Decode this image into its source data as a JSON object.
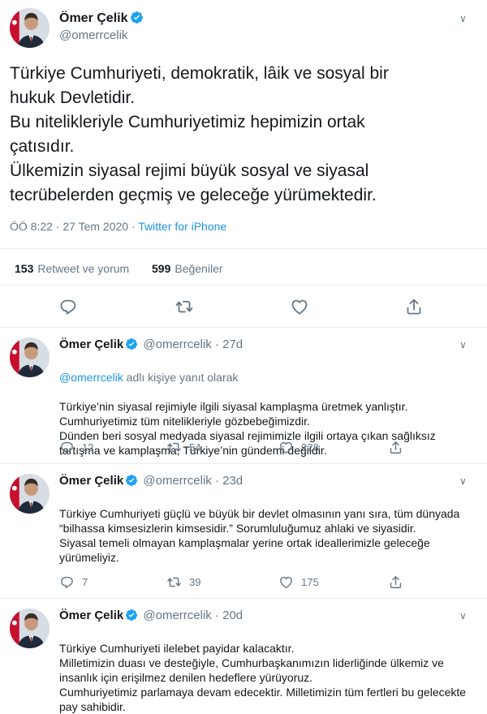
{
  "main_tweet": {
    "name": "Ömer Çelik",
    "handle": "@omerrcelik",
    "text": "Türkiye Cumhuriyeti, demokratik, lâik ve sosyal bir\nhukuk Devletidir.\nBu nitelikleriyle Cumhuriyetimiz hepimizin ortak\nçatısıdır.\nÜlkemizin siyasal rejimi büyük sosyal ve siyasal\ntecrübelerden geçmiş ve geleceğe yürümektedir.",
    "time": "ÖÖ 8:22 · 27 Tem 2020 · ",
    "source": "Twitter for iPhone",
    "retweets": "153",
    "retweets_label": "Retweet ve yorum",
    "likes": "599",
    "likes_label": "Beğeniler",
    "icons": [
      "reply-icon",
      "retweet-icon",
      "like-icon",
      "share-icon"
    ]
  },
  "replies": [
    {
      "name": "Ömer Çelik",
      "handle": "@omerrcelik · 27d",
      "reply_to_mention": "@omerrcelik",
      "reply_to_suffix": " adlı kişiye yanıt olarak",
      "text": "Türkiye’nin siyasal rejimiyle ilgili siyasal kamplaşma üretmek yanlıştır.\nCumhuriyetimiz tüm nitelikleriyle gözbebeğimizdir.\nDünden beri sosyal medyada siyasal rejimimizle ilgili ortaya çıkan sağlıksız tartışma ve kamplaşma, Türkiye’nin gündemi değildir.",
      "replies": "12",
      "retweets": "54",
      "likes": "228"
    },
    {
      "name": "Ömer Çelik",
      "handle": "@omerrcelik · 23d",
      "text": "Türkiye Cumhuriyeti güçlü ve büyük bir devlet olmasının yanı sıra, tüm dünyada “bilhassa kimsesizlerin kimsesidir.” Sorumluluğumuz ahlaki ve siyasidir.\nSiyasal temeli olmayan kamplaşmalar yerine ortak ideallerimizle geleceğe yürümeliyiz.",
      "replies": "7",
      "retweets": "39",
      "likes": "175"
    },
    {
      "name": "Ömer Çelik",
      "handle": "@omerrcelik · 20d",
      "text": "Türkiye Cumhuriyeti ilelebet payidar kalacaktır.\nMilletimizin duası ve desteğiyle, Cumhurbaşkanımızın liderliğinde ülkemiz ve insanlık için erişilmez denilen hedeflere yürüyoruz.\nCumhuriyetimiz parlamaya devam edecektir. Milletimizin tüm fertleri bu gelecekte pay sahibidir."
    }
  ],
  "colors": {
    "accent": "#1b95e0",
    "secondary_text": "#657786",
    "border": "#e6ecf0",
    "verified": "#1da1f2"
  }
}
